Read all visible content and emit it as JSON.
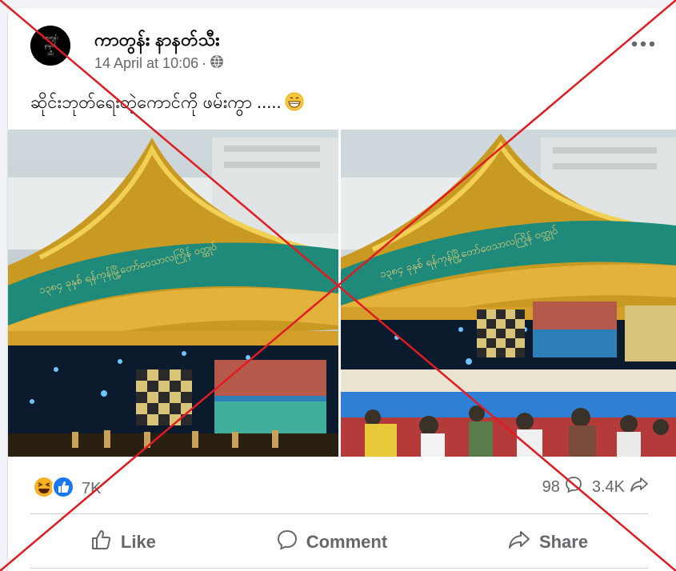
{
  "post": {
    "author": "ကာတွန်း နာနတ်သီး",
    "avatar_text": "ကာတွန်း နာနတ်သီး",
    "timestamp": "14 April at 10:06",
    "separator": "·",
    "privacy_icon": "globe-icon",
    "more_icon": "more-options-icon",
    "text": "ဆိုင်းဘုတ်ရေးတဲ့ကောင်ကို ဖမ်းကွာ .....",
    "text_emoji": "😁",
    "sign_text": "၁၃၈၄ ခုနှစ် ရန်ကုန်မြို့တော်ဝေသာလကြိုန် ဝတ္ထုဝ်"
  },
  "stats": {
    "reactions_count": "7K",
    "reaction_icons": [
      "laugh-reaction-icon",
      "like-reaction-icon"
    ],
    "comments_count": "98",
    "shares_count": "3.4K"
  },
  "actions": {
    "like": "Like",
    "comment": "Comment",
    "share": "Share"
  },
  "colors": {
    "like_blue": "#1877f2",
    "haha_yellow": "#f7b125",
    "overlay_red": "#e01b22",
    "banner_teal": "#1c8a7e",
    "gold": "#d8a92a"
  }
}
